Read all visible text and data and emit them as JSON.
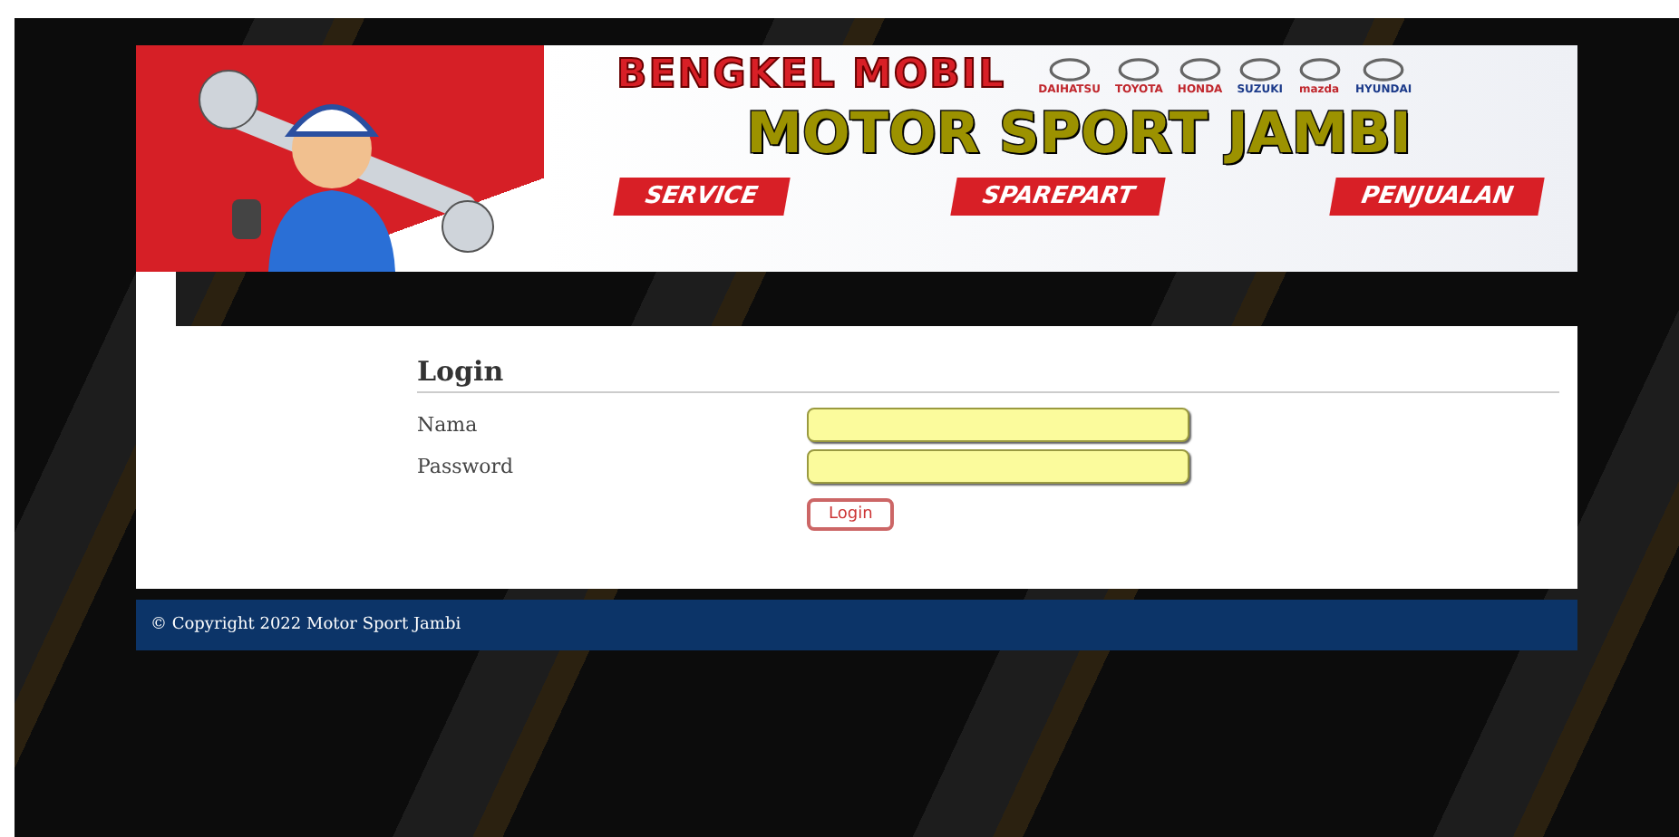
{
  "banner": {
    "title": "BENGKEL MOBIL",
    "brands": [
      "DAIHATSU",
      "TOYOTA",
      "HONDA",
      "SUZUKI",
      "mazda",
      "HYUNDAI"
    ],
    "name": "MOTOR SPORT JAMBI",
    "menu": [
      "SERVICE",
      "SPAREPART",
      "PENJUALAN"
    ]
  },
  "login": {
    "heading": "Login",
    "fields": [
      {
        "label": "Nama"
      },
      {
        "label": "Password"
      }
    ],
    "button": "Login"
  },
  "footer": "© Copyright 2022 Motor Sport Jambi"
}
